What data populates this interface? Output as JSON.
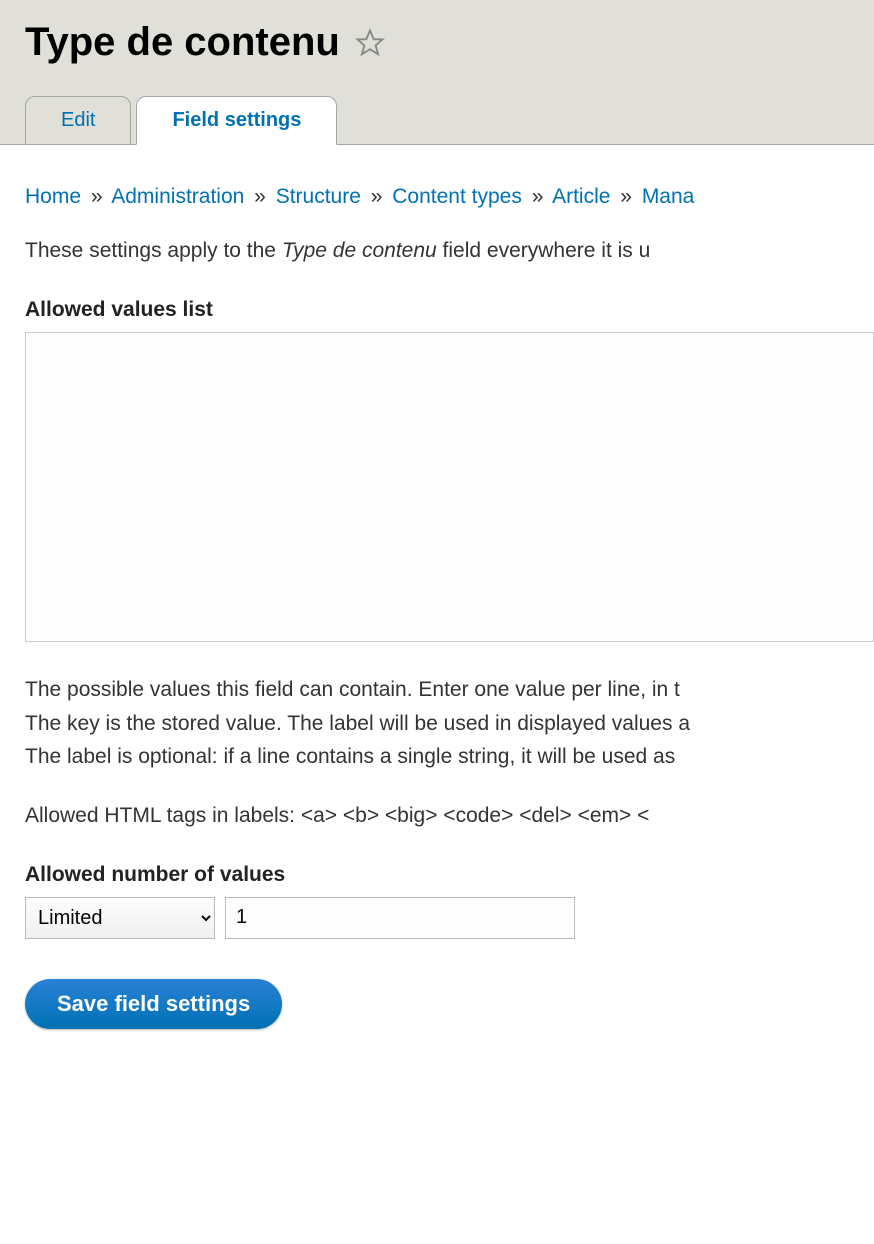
{
  "page_title": "Type de contenu",
  "tabs": {
    "edit": "Edit",
    "field_settings": "Field settings"
  },
  "breadcrumb": {
    "home": "Home",
    "administration": "Administration",
    "structure": "Structure",
    "content_types": "Content types",
    "article": "Article",
    "mana": "Mana"
  },
  "description_prefix": "These settings apply to the ",
  "description_field": "Type de contenu",
  "description_suffix": " field everywhere it is u",
  "allowed_values_label": "Allowed values list",
  "allowed_values_value": "",
  "help_text_line1": "The possible values this field can contain. Enter one value per line, in t",
  "help_text_line2": "The key is the stored value. The label will be used in displayed values a",
  "help_text_line3": "The label is optional: if a line contains a single string, it will be used as",
  "allowed_tags_text": "Allowed HTML tags in labels: <a> <b> <big> <code> <del> <em> <",
  "cardinality_label": "Allowed number of values",
  "cardinality_select": "Limited",
  "cardinality_number": "1",
  "submit_label": "Save field settings"
}
